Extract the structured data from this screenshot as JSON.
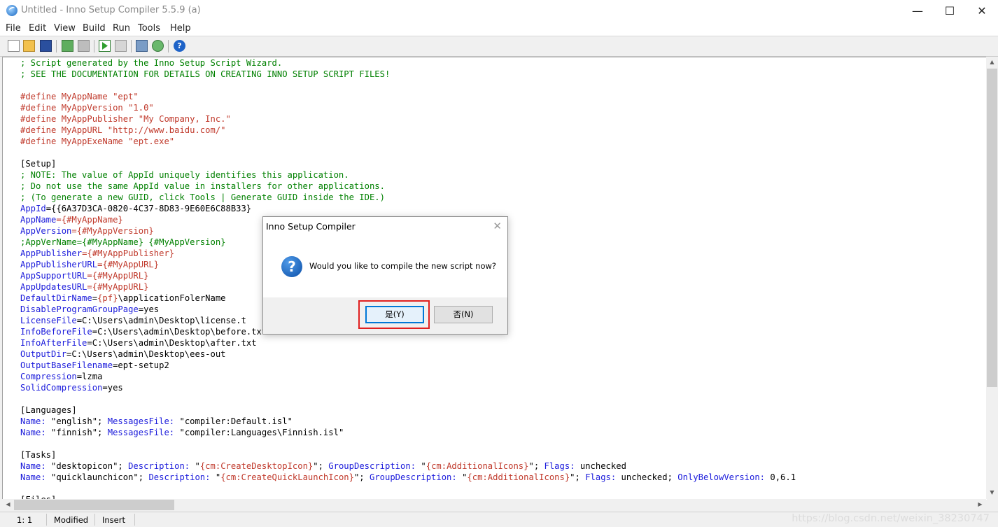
{
  "window": {
    "title": "Untitled - Inno Setup Compiler 5.5.9 (a)",
    "minimize": "—",
    "maximize": "☐",
    "close": "✕"
  },
  "menu": [
    "File",
    "Edit",
    "View",
    "Build",
    "Run",
    "Tools",
    "Help"
  ],
  "toolbar": {
    "icons": [
      "new-file-icon",
      "open-folder-icon",
      "save-icon",
      "compile-icon",
      "stop-compile-icon",
      "run-icon",
      "pause-icon",
      "target-icon",
      "refresh-icon",
      "help-icon"
    ],
    "help_glyph": "?"
  },
  "editor": {
    "lines": [
      [
        {
          "t": "; Script generated by the Inno Setup Script Wizard.",
          "c": "#008000"
        }
      ],
      [
        {
          "t": "; SEE THE DOCUMENTATION FOR DETAILS ON CREATING INNO SETUP SCRIPT FILES!",
          "c": "#008000"
        }
      ],
      [],
      [
        {
          "t": "#define MyAppName \"ept\"",
          "c": "#c0392b"
        }
      ],
      [
        {
          "t": "#define MyAppVersion \"1.0\"",
          "c": "#c0392b"
        }
      ],
      [
        {
          "t": "#define MyAppPublisher \"My Company, Inc.\"",
          "c": "#c0392b"
        }
      ],
      [
        {
          "t": "#define MyAppURL \"http://www.baidu.com/\"",
          "c": "#c0392b"
        }
      ],
      [
        {
          "t": "#define MyAppExeName \"ept.exe\"",
          "c": "#c0392b"
        }
      ],
      [],
      [
        {
          "t": "[Setup]",
          "c": "#000000"
        }
      ],
      [
        {
          "t": "; NOTE: The value of AppId uniquely identifies this application.",
          "c": "#008000"
        }
      ],
      [
        {
          "t": "; Do not use the same AppId value in installers for other applications.",
          "c": "#008000"
        }
      ],
      [
        {
          "t": "; (To generate a new GUID, click Tools | Generate GUID inside the IDE.)",
          "c": "#008000"
        }
      ],
      [
        {
          "t": "AppId",
          "c": "#1a1adb"
        },
        {
          "t": "={{6A37D3CA-0820-4C37-8D83-9E60E6C88B33}",
          "c": "#000000"
        }
      ],
      [
        {
          "t": "AppName",
          "c": "#1a1adb"
        },
        {
          "t": "={#MyAppName}",
          "c": "#c0392b"
        }
      ],
      [
        {
          "t": "AppVersion",
          "c": "#1a1adb"
        },
        {
          "t": "={#MyAppVersion}",
          "c": "#c0392b"
        }
      ],
      [
        {
          "t": ";AppVerName={#MyAppName} {#MyAppVersion}",
          "c": "#008000"
        }
      ],
      [
        {
          "t": "AppPublisher",
          "c": "#1a1adb"
        },
        {
          "t": "={#MyAppPublisher}",
          "c": "#c0392b"
        }
      ],
      [
        {
          "t": "AppPublisherURL",
          "c": "#1a1adb"
        },
        {
          "t": "={#MyAppURL}",
          "c": "#c0392b"
        }
      ],
      [
        {
          "t": "AppSupportURL",
          "c": "#1a1adb"
        },
        {
          "t": "={#MyAppURL}",
          "c": "#c0392b"
        }
      ],
      [
        {
          "t": "AppUpdatesURL",
          "c": "#1a1adb"
        },
        {
          "t": "={#MyAppURL}",
          "c": "#c0392b"
        }
      ],
      [
        {
          "t": "DefaultDirName",
          "c": "#1a1adb"
        },
        {
          "t": "=",
          "c": "#000000"
        },
        {
          "t": "{pf}",
          "c": "#c0392b"
        },
        {
          "t": "\\applicationFolerName",
          "c": "#000000"
        }
      ],
      [
        {
          "t": "DisableProgramGroupPage",
          "c": "#1a1adb"
        },
        {
          "t": "=yes",
          "c": "#000000"
        }
      ],
      [
        {
          "t": "LicenseFile",
          "c": "#1a1adb"
        },
        {
          "t": "=C:\\Users\\admin\\Desktop\\license.t",
          "c": "#000000"
        }
      ],
      [
        {
          "t": "InfoBeforeFile",
          "c": "#1a1adb"
        },
        {
          "t": "=C:\\Users\\admin\\Desktop\\before.txt",
          "c": "#000000"
        }
      ],
      [
        {
          "t": "InfoAfterFile",
          "c": "#1a1adb"
        },
        {
          "t": "=C:\\Users\\admin\\Desktop\\after.txt",
          "c": "#000000"
        }
      ],
      [
        {
          "t": "OutputDir",
          "c": "#1a1adb"
        },
        {
          "t": "=C:\\Users\\admin\\Desktop\\ees-out",
          "c": "#000000"
        }
      ],
      [
        {
          "t": "OutputBaseFilename",
          "c": "#1a1adb"
        },
        {
          "t": "=ept-setup2",
          "c": "#000000"
        }
      ],
      [
        {
          "t": "Compression",
          "c": "#1a1adb"
        },
        {
          "t": "=lzma",
          "c": "#000000"
        }
      ],
      [
        {
          "t": "SolidCompression",
          "c": "#1a1adb"
        },
        {
          "t": "=yes",
          "c": "#000000"
        }
      ],
      [],
      [
        {
          "t": "[Languages]",
          "c": "#000000"
        }
      ],
      [
        {
          "t": "Name:",
          "c": "#1a1adb"
        },
        {
          "t": " \"english\"; ",
          "c": "#000000"
        },
        {
          "t": "MessagesFile:",
          "c": "#1a1adb"
        },
        {
          "t": " \"compiler:Default.isl\"",
          "c": "#000000"
        }
      ],
      [
        {
          "t": "Name:",
          "c": "#1a1adb"
        },
        {
          "t": " \"finnish\"; ",
          "c": "#000000"
        },
        {
          "t": "MessagesFile:",
          "c": "#1a1adb"
        },
        {
          "t": " \"compiler:Languages\\Finnish.isl\"",
          "c": "#000000"
        }
      ],
      [],
      [
        {
          "t": "[Tasks]",
          "c": "#000000"
        }
      ],
      [
        {
          "t": "Name:",
          "c": "#1a1adb"
        },
        {
          "t": " \"desktopicon\"; ",
          "c": "#000000"
        },
        {
          "t": "Description:",
          "c": "#1a1adb"
        },
        {
          "t": " \"",
          "c": "#000000"
        },
        {
          "t": "{cm:CreateDesktopIcon}",
          "c": "#c0392b"
        },
        {
          "t": "\"; ",
          "c": "#000000"
        },
        {
          "t": "GroupDescription:",
          "c": "#1a1adb"
        },
        {
          "t": " \"",
          "c": "#000000"
        },
        {
          "t": "{cm:AdditionalIcons}",
          "c": "#c0392b"
        },
        {
          "t": "\"; ",
          "c": "#000000"
        },
        {
          "t": "Flags:",
          "c": "#1a1adb"
        },
        {
          "t": " unchecked",
          "c": "#000000"
        }
      ],
      [
        {
          "t": "Name:",
          "c": "#1a1adb"
        },
        {
          "t": " \"quicklaunchicon\"; ",
          "c": "#000000"
        },
        {
          "t": "Description:",
          "c": "#1a1adb"
        },
        {
          "t": " \"",
          "c": "#000000"
        },
        {
          "t": "{cm:CreateQuickLaunchIcon}",
          "c": "#c0392b"
        },
        {
          "t": "\"; ",
          "c": "#000000"
        },
        {
          "t": "GroupDescription:",
          "c": "#1a1adb"
        },
        {
          "t": " \"",
          "c": "#000000"
        },
        {
          "t": "{cm:AdditionalIcons}",
          "c": "#c0392b"
        },
        {
          "t": "\"; ",
          "c": "#000000"
        },
        {
          "t": "Flags:",
          "c": "#1a1adb"
        },
        {
          "t": " unchecked; ",
          "c": "#000000"
        },
        {
          "t": "OnlyBelowVersion:",
          "c": "#1a1adb"
        },
        {
          "t": " 0,6.1",
          "c": "#000000"
        }
      ],
      [],
      [
        {
          "t": "[Files]",
          "c": "#000000"
        }
      ]
    ]
  },
  "dialog": {
    "title": "Inno Setup Compiler",
    "close": "✕",
    "icon": "question-icon",
    "icon_glyph": "?",
    "message": "Would you like to compile the new script now?",
    "yes_label": "是(Y)",
    "no_label": "否(N)"
  },
  "status": {
    "position": "1:  1",
    "modified": "Modified",
    "mode": "Insert"
  },
  "watermark": "https://blog.csdn.net/weixin_38230747",
  "colors": {
    "comment": "#008000",
    "directive": "#c0392b",
    "key": "#1a1adb",
    "highlight": "#e02020"
  }
}
